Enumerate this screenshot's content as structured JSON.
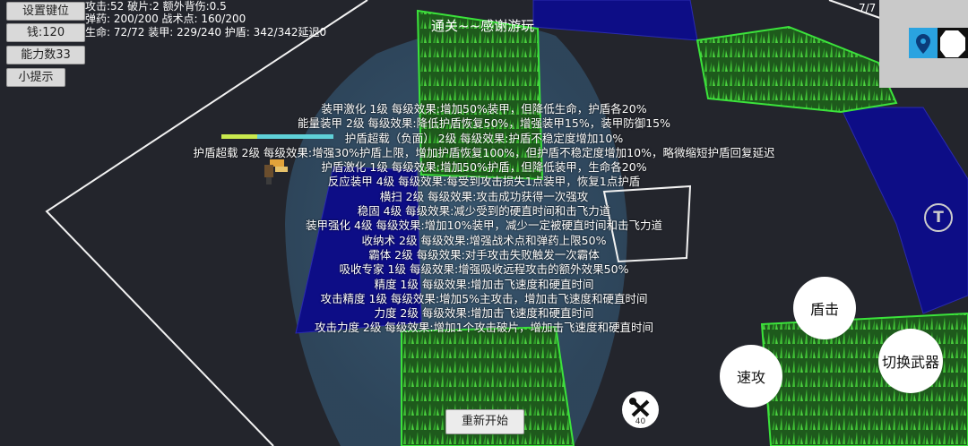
{
  "menu": {
    "keybind_label": "设置键位",
    "money_label": "钱:120",
    "ability_label": "能力数33",
    "tips_label": "小提示"
  },
  "stats": {
    "line1": "攻击:52 破片:2 额外背伤:0.5",
    "line2": "弹药: 200/200 战术点: 160/200",
    "line3": "生命: 72/72 装甲: 229/240 护盾: 342/342延迟0"
  },
  "title": "通关~~感谢游玩",
  "skills": [
    "装甲激化 1级 每级效果:增加50%装甲，但降低生命，护盾各20%",
    "能量装甲 2级 每级效果:降低护盾恢复50%，增强装甲15%，装甲防御15%",
    "护盾超载（负面） 2级 每级效果:护盾不稳定度增加10%",
    "护盾超载 2级 每级效果:增强30%护盾上限，增加护盾恢复100%，但护盾不稳定度增加10%，略微缩短护盾回复延迟",
    "护盾激化 1级 每级效果:增加50%护盾，但降低装甲，生命各20%",
    "反应装甲 4级 每级效果:每受到攻击损失1点装甲，恢复1点护盾",
    "横扫 2级 每级效果:攻击成功获得一次强攻",
    "稳固 4级 每级效果:减少受到的硬直时间和击飞力道",
    "装甲强化 4级 每级效果:增加10%装甲，减少一定被硬直时间和击飞力道",
    "收纳术 2级 每级效果:增强战术点和弹药上限50%",
    "霸体 2级 每级效果:对手攻击失败触发一次霸体",
    "吸收专家 1级 每级效果:增强吸收远程攻击的额外效果50%",
    "精度 1级 每级效果:增加击飞速度和硬直时间",
    "攻击精度 1级 每级效果:增加5%主攻击，增加击飞速度和硬直时间",
    "力度 2级 每级效果:增加击飞速度和硬直时间",
    "攻击力度 2级 每级效果:增加1个攻击破片，增加击飞速度和硬直时间"
  ],
  "actions": {
    "shield_label": "盾击",
    "quick_label": "速攻",
    "switch_label": "切换武器",
    "restart_label": "重新开始"
  },
  "minimap": {
    "page": "7/7"
  },
  "tool": {
    "count": "40"
  },
  "colors": {
    "background": "#23252c",
    "wall_blue": "#0d0d86",
    "grass_green": "#2faa2a",
    "outline_green": "#39e039",
    "light_cone": "#3c6b8f"
  },
  "icons": [
    "location-pin-icon",
    "octagon-icon",
    "wrench-screwdriver-icon",
    "t-circle-icon"
  ]
}
